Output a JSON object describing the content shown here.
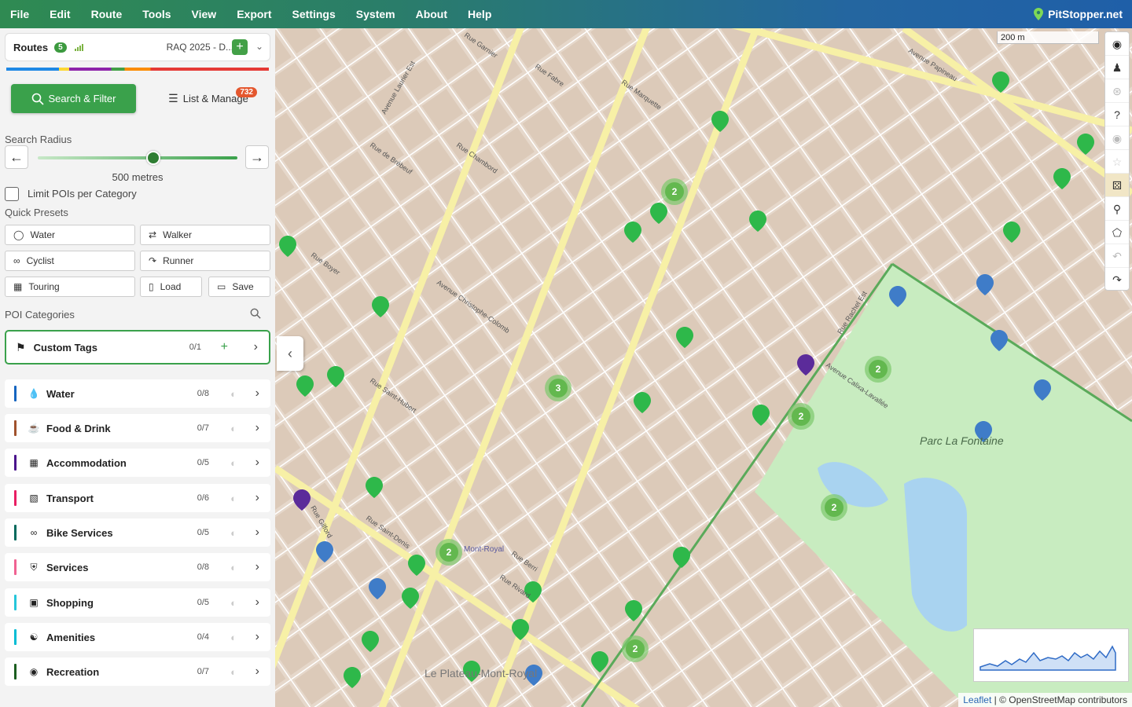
{
  "menu": {
    "items": [
      "File",
      "Edit",
      "Route",
      "Tools",
      "View",
      "Export",
      "Settings",
      "System",
      "About",
      "Help"
    ],
    "brand": "PitStopper.net"
  },
  "routes": {
    "label": "Routes",
    "count": "5",
    "selected": "RAQ 2025 - D..."
  },
  "tabs": {
    "search_label": "Search & Filter",
    "list_label": "List & Manage",
    "list_badge": "732"
  },
  "search_radius": {
    "title": "Search Radius",
    "value_text": "500 metres",
    "level_fraction": 0.58
  },
  "limit_label": "Limit POIs per Category",
  "presets": {
    "title": "Quick Presets",
    "items": [
      {
        "label": "Water",
        "icon": "drop-icon"
      },
      {
        "label": "Walker",
        "icon": "walker-icon"
      },
      {
        "label": "Cyclist",
        "icon": "bike-icon"
      },
      {
        "label": "Runner",
        "icon": "runner-icon"
      },
      {
        "label": "Touring",
        "icon": "bus-icon"
      },
      {
        "label": "Load",
        "icon": "load-icon"
      },
      {
        "label": "Save",
        "icon": "save-icon"
      }
    ]
  },
  "poi": {
    "title": "POI Categories",
    "custom": {
      "label": "Custom Tags",
      "count": "0/1"
    },
    "categories": [
      {
        "name": "Water",
        "count": "0/8",
        "color": "#1565c0",
        "icon": "drop-icon"
      },
      {
        "name": "Food & Drink",
        "count": "0/7",
        "color": "#a0522d",
        "icon": "cup-icon"
      },
      {
        "name": "Accommodation",
        "count": "0/5",
        "color": "#4a148c",
        "icon": "building-icon"
      },
      {
        "name": "Transport",
        "count": "0/6",
        "color": "#e91e63",
        "icon": "bus-icon"
      },
      {
        "name": "Bike Services",
        "count": "0/5",
        "color": "#00695c",
        "icon": "bike-icon"
      },
      {
        "name": "Services",
        "count": "0/8",
        "color": "#f06292",
        "icon": "shield-icon"
      },
      {
        "name": "Shopping",
        "count": "0/5",
        "color": "#26c6da",
        "icon": "cart-icon"
      },
      {
        "name": "Amenities",
        "count": "0/4",
        "color": "#00bcd4",
        "icon": "people-icon"
      },
      {
        "name": "Recreation",
        "count": "0/7",
        "color": "#1b5e20",
        "icon": "eye-icon"
      }
    ]
  },
  "map": {
    "scale_text": "200 m",
    "park_name": "Parc La Fontaine",
    "district_name": "Le Plateau-Mont-Royal",
    "metro_label": "Mont-Royal",
    "streets": [
      "Rue Rachel Est",
      "Avenue Papineau",
      "Rue Saint-Denis",
      "Rue de Brébeuf",
      "Rue Chambord",
      "Avenue Calixa-Lavallée",
      "Rue Marquette",
      "Rue Garnier",
      "Rue Fabre",
      "Avenue Christophe-Colomb",
      "Rue Boyer",
      "Rue Saint-Hubert",
      "Rue Berri",
      "Rue Rivard",
      "Avenue Laurier Est",
      "Rue Gilford"
    ],
    "clusters": [
      "2",
      "3",
      "2",
      "2",
      "2",
      "2",
      "2"
    ],
    "attribution_leaflet": "Leaflet",
    "attribution_rest": "| © OpenStreetMap contributors"
  }
}
